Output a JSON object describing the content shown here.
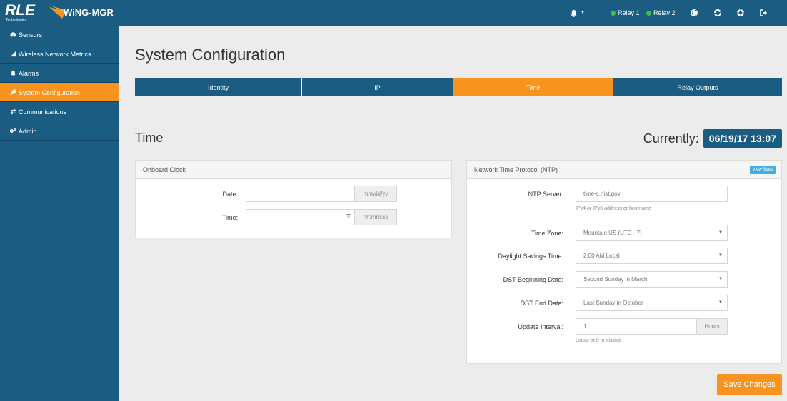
{
  "brand": {
    "logo_main": "RLE",
    "logo_sub": "Technologies",
    "product": "WiNG-MGR"
  },
  "topbar": {
    "icons": [
      "bell-icon",
      "caret-down-icon",
      "globe-icon",
      "refresh-icon",
      "lifebuoy-icon",
      "sign-out-icon"
    ],
    "relay1": "Relay 1",
    "relay2": "Relay 2",
    "relay_color": "#39c24a"
  },
  "sidebar": {
    "items": [
      {
        "label": "Sensors",
        "icon": "tachometer-icon"
      },
      {
        "label": "Wireless Network Metrics",
        "icon": "signal-icon"
      },
      {
        "label": "Alarms",
        "icon": "bell-icon"
      },
      {
        "label": "System Configuration",
        "icon": "wrench-icon",
        "active": true
      },
      {
        "label": "Communications",
        "icon": "exchange-icon"
      },
      {
        "label": "Admin",
        "icon": "cogs-icon"
      }
    ]
  },
  "page": {
    "title": "System Configuration",
    "tabs": [
      {
        "label": "Identity"
      },
      {
        "label": "IP"
      },
      {
        "label": "Time",
        "active": true
      },
      {
        "label": "Relay Outputs"
      }
    ],
    "section_title": "Time",
    "currently_label": "Currently:",
    "currently_value": "06/19/17 13:07"
  },
  "onboard_clock": {
    "title": "Onboard Clock",
    "date_label": "Date:",
    "date_value": "",
    "date_addon": "mm/dd/yy",
    "time_label": "Time:",
    "time_value": "",
    "time_addon": "hh:mm:ss"
  },
  "ntp": {
    "title": "Network Time Protocol (NTP)",
    "view_stats": "View Stats",
    "server_label": "NTP Server:",
    "server_value": "time-c.nist.gov",
    "server_help": "IPv4 or IPv6 address or hostname",
    "timezone_label": "Time Zone:",
    "timezone_value": "Mountain US (UTC - 7)",
    "dst_label": "Daylight Savings Time:",
    "dst_value": "2:00 AM Local",
    "dst_begin_label": "DST Beginning Date:",
    "dst_begin_value": "Second Sunday in March",
    "dst_end_label": "DST End Date:",
    "dst_end_value": "Last Sunday in October",
    "interval_label": "Update Interval:",
    "interval_value": "1",
    "interval_addon": "Hours",
    "interval_help": "Leave at 0 to disable"
  },
  "save_button": "Save Changes",
  "colors": {
    "primary": "#1a5c82",
    "accent": "#f7931e",
    "info": "#45aee0"
  }
}
